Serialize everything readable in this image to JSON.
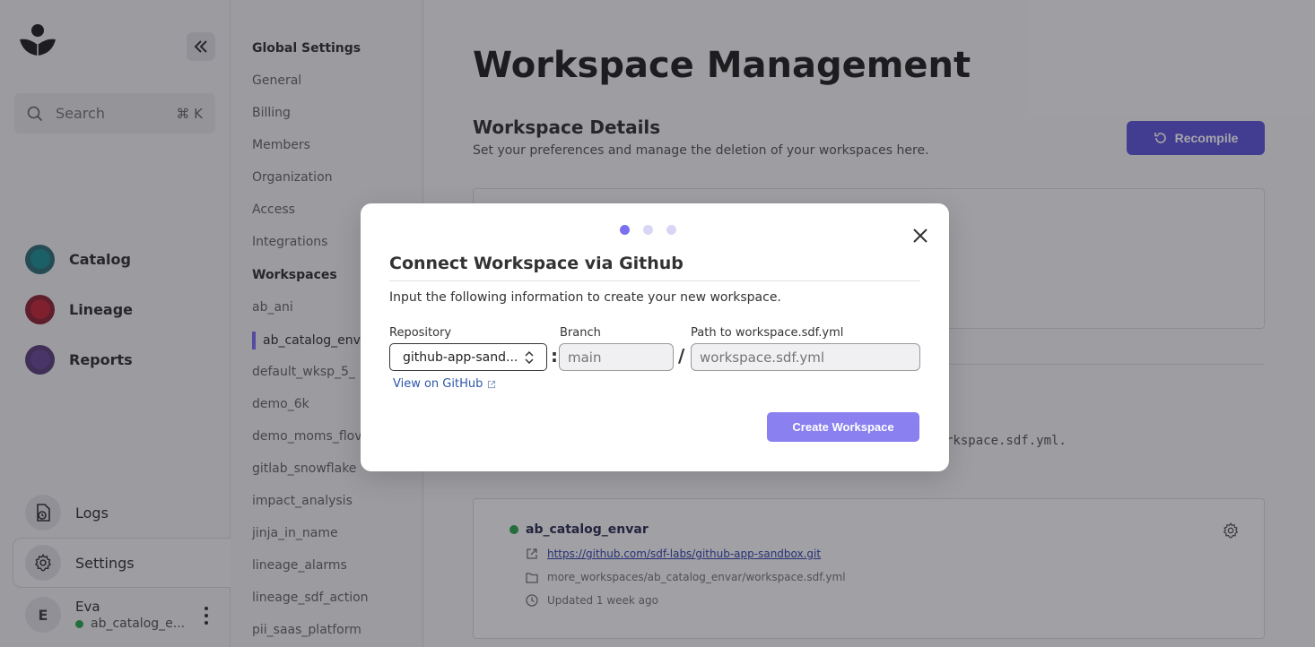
{
  "sidebar": {
    "search": {
      "label": "Search",
      "shortcut": "⌘ K"
    },
    "nav": [
      {
        "label": "Catalog",
        "outer": "#2f6f76",
        "inner": "#1f8f93"
      },
      {
        "label": "Lineage",
        "outer": "#8b2434",
        "inner": "#c2273a"
      },
      {
        "label": "Reports",
        "outer": "#5b3f7a",
        "inner": "#6a4a96"
      }
    ],
    "bottom": {
      "logs": "Logs",
      "settings": "Settings"
    },
    "user": {
      "initial": "E",
      "name": "Eva",
      "workspace": "ab_catalog_e..."
    }
  },
  "settings_nav": {
    "global_title": "Global Settings",
    "global_items": [
      "General",
      "Billing",
      "Members",
      "Organization",
      "Access",
      "Integrations"
    ],
    "workspaces_title": "Workspaces",
    "workspace_items": [
      "ab_ani",
      "ab_catalog_enva",
      "default_wksp_5_",
      "demo_6k",
      "demo_moms_flov",
      "gitlab_snowflake",
      "impact_analysis",
      "jinja_in_name",
      "lineage_alarms",
      "lineage_sdf_action",
      "pii_saas_platform"
    ]
  },
  "main": {
    "title": "Workspace Management",
    "section_title": "Workspace Details",
    "section_subtitle": "Set your preferences and manage the deletion of your workspaces here.",
    "recompile_label": "Recompile",
    "hidden_text_tail": "rkspace.sdf.yml.",
    "workspace_card": {
      "name": "ab_catalog_envar",
      "repo_url": "https://github.com/sdf-labs/github-app-sandbox.git",
      "path": "more_workspaces/ab_catalog_envar/workspace.sdf.yml",
      "updated": "Updated 1 week ago"
    }
  },
  "modal": {
    "title": "Connect Workspace via Github",
    "description": "Input the following information to create your new workspace.",
    "repository_label": "Repository",
    "repository_value": "github-app-sand...",
    "branch_label": "Branch",
    "branch_placeholder": "main",
    "path_label": "Path to workspace.sdf.yml",
    "path_placeholder": "workspace.sdf.yml",
    "view_link": "View on GitHub",
    "create_label": "Create Workspace",
    "sep_colon": ":",
    "sep_slash": "/"
  },
  "colors": {
    "accent": "#7a6ff0",
    "primary_button": "#5e56d9",
    "status_green": "#2ea44f"
  }
}
